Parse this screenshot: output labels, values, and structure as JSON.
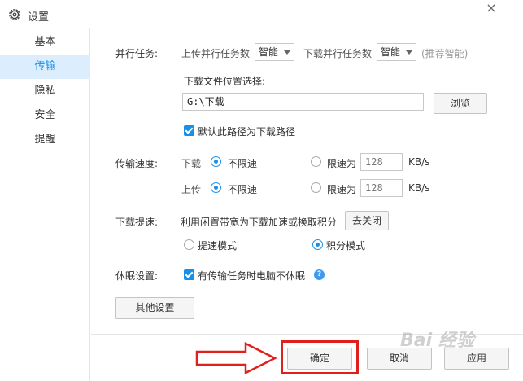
{
  "window": {
    "title": "设置",
    "close": "×"
  },
  "sidebar": {
    "items": [
      {
        "label": "基本"
      },
      {
        "label": "传输",
        "active": true
      },
      {
        "label": "隐私"
      },
      {
        "label": "安全"
      },
      {
        "label": "提醒"
      }
    ]
  },
  "parallel": {
    "label": "并行任务:",
    "upload_label": "上传并行任务数",
    "upload_value": "智能",
    "download_label": "下载并行任务数",
    "download_value": "智能",
    "hint": "(推荐智能)"
  },
  "download_location": {
    "label": "下载文件位置选择:",
    "path": "G:\\下载",
    "browse": "浏览",
    "default_checkbox": "默认此路径为下载路径",
    "default_checked": true
  },
  "speed": {
    "label": "传输速度:",
    "download_label": "下载",
    "upload_label": "上传",
    "unlimited": "不限速",
    "limit_to": "限速为",
    "download_limit_value": "128",
    "upload_limit_value": "128",
    "unit": "KB/s",
    "download_mode": "不限速",
    "upload_mode": "不限速"
  },
  "boost": {
    "label": "下载提速:",
    "description": "利用闲置带宽为下载加速或换取积分",
    "close_button": "去关闭",
    "mode_speed": "提速模式",
    "mode_points": "积分模式",
    "selected": "积分模式"
  },
  "sleep": {
    "label": "休眠设置:",
    "checkbox": "有传输任务时电脑不休眠",
    "checked": true
  },
  "other_settings": "其他设置",
  "footer": {
    "ok": "确定",
    "cancel": "取消",
    "apply": "应用"
  },
  "watermark": "Bai 经验",
  "colors": {
    "accent": "#1a8fe8",
    "active_bg": "#dceefd",
    "highlight_red": "#e0201c"
  }
}
